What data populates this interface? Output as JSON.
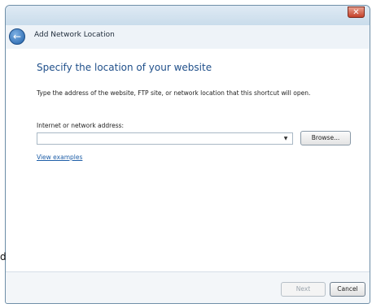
{
  "window": {
    "title": "Add Network Location",
    "close_glyph": "✕"
  },
  "header": {
    "back_glyph": "←"
  },
  "content": {
    "heading": "Specify the location of your website",
    "instruction": "Type the address of the website, FTP site, or network location that this shortcut will open.",
    "address_label": "Internet or network address:",
    "address_value": "",
    "dropdown_glyph": "▼",
    "browse_label": "Browse...",
    "view_examples": "View examples"
  },
  "footer": {
    "next_label": "Next",
    "cancel_label": "Cancel"
  },
  "stray_text": "d",
  "colors": {
    "heading": "#1f4f8a",
    "link": "#1f5fa8",
    "close_button": "#c4412a"
  }
}
